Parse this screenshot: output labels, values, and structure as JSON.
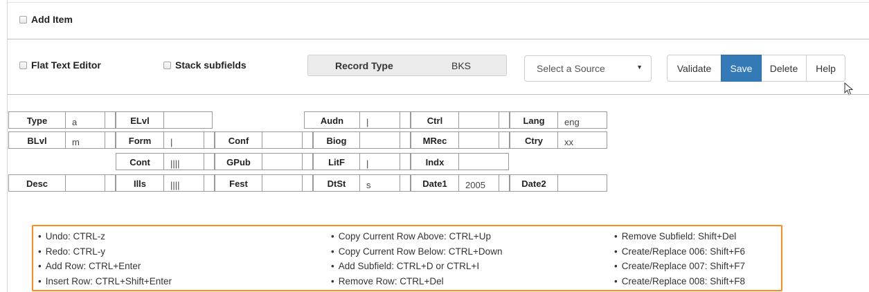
{
  "add_item": {
    "label": "Add Item"
  },
  "options": {
    "flat_text_editor": "Flat Text Editor",
    "stack_subfields": "Stack subfields"
  },
  "record_type": {
    "label": "Record Type",
    "value": "BKS"
  },
  "source_select": {
    "selected": "Select a Source",
    "caret": "▼"
  },
  "buttons": {
    "validate": "Validate",
    "save": "Save",
    "delete": "Delete",
    "help": "Help"
  },
  "fixed_fields": [
    {
      "label": "Type",
      "value": "a"
    },
    {
      "label": "ELvl",
      "value": ""
    },
    {
      "label": "Audn",
      "value": "|"
    },
    {
      "label": "Ctrl",
      "value": ""
    },
    {
      "label": "Lang",
      "value": "eng"
    },
    {
      "label": "BLvl",
      "value": "m"
    },
    {
      "label": "Form",
      "value": "|"
    },
    {
      "label": "Conf",
      "value": ""
    },
    {
      "label": "Biog",
      "value": ""
    },
    {
      "label": "MRec",
      "value": ""
    },
    {
      "label": "Ctry",
      "value": "xx"
    },
    {
      "label": "Cont",
      "value": "||||"
    },
    {
      "label": "GPub",
      "value": ""
    },
    {
      "label": "LitF",
      "value": "|"
    },
    {
      "label": "Indx",
      "value": ""
    },
    {
      "label": "Desc",
      "value": ""
    },
    {
      "label": "Ills",
      "value": "||||"
    },
    {
      "label": "Fest",
      "value": ""
    },
    {
      "label": "DtSt",
      "value": "s"
    },
    {
      "label": "Date1",
      "value": "2005"
    },
    {
      "label": "Date2",
      "value": ""
    }
  ],
  "shortcuts": {
    "col1": [
      "Undo: CTRL-z",
      "Redo: CTRL-y",
      "Add Row: CTRL+Enter",
      "Insert Row: CTRL+Shift+Enter"
    ],
    "col2": [
      "Copy Current Row Above: CTRL+Up",
      "Copy Current Row Below: CTRL+Down",
      "Add Subfield: CTRL+D or CTRL+I",
      "Remove Row: CTRL+Del"
    ],
    "col3": [
      "Remove Subfield: Shift+Del",
      "Create/Replace 006: Shift+F6",
      "Create/Replace 007: Shift+F7",
      "Create/Replace 008: Shift+F8"
    ]
  },
  "colors": {
    "primary": "#337ab7",
    "highlight_border": "#ff8c1a"
  }
}
